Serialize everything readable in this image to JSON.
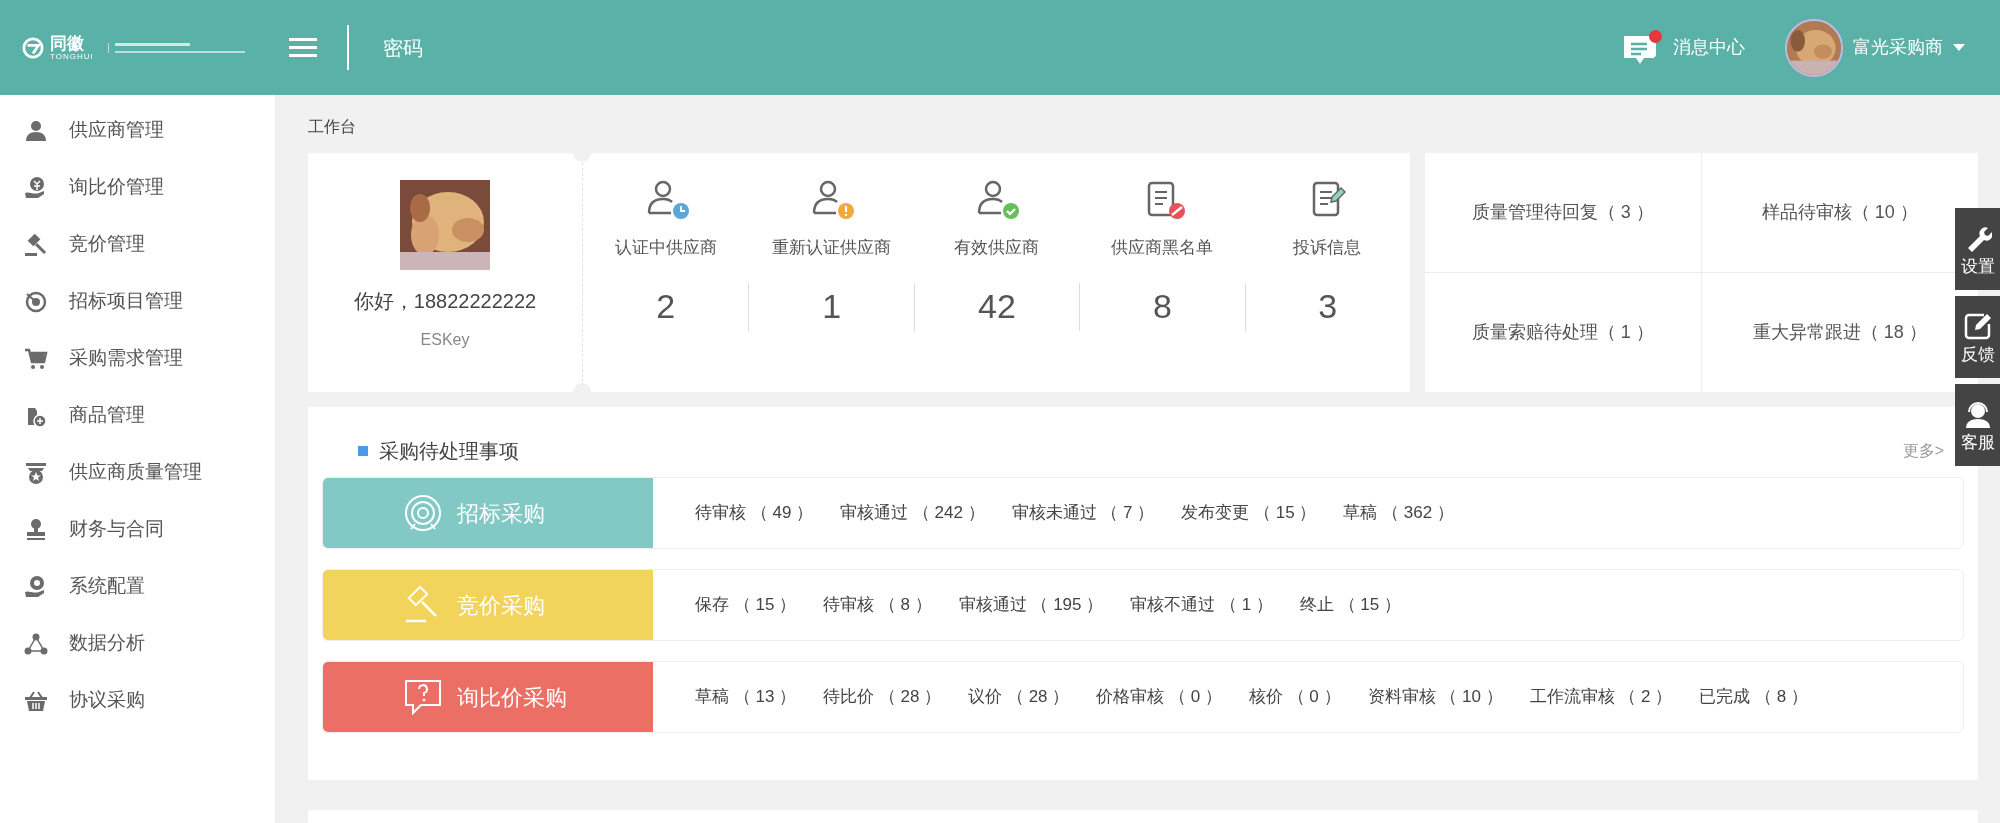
{
  "header": {
    "logo": {
      "name": "同徽",
      "subtitle": "TONGHUI"
    },
    "page_title": "密码",
    "messages": {
      "label": "消息中心",
      "unread": true
    },
    "user": {
      "name": "富光采购商"
    }
  },
  "sidebar": {
    "items": [
      {
        "kind": "person",
        "label": "供应商管理"
      },
      {
        "kind": "money",
        "label": "询比价管理"
      },
      {
        "kind": "gavel",
        "label": "竞价管理"
      },
      {
        "kind": "target",
        "label": "招标项目管理"
      },
      {
        "kind": "cart",
        "label": "采购需求管理"
      },
      {
        "kind": "tag",
        "label": "商品管理"
      },
      {
        "kind": "medal",
        "label": "供应商质量管理"
      },
      {
        "kind": "stamp",
        "label": "财务与合同"
      },
      {
        "kind": "gear",
        "label": "系统配置"
      },
      {
        "kind": "nodes",
        "label": "数据分析"
      },
      {
        "kind": "basket",
        "label": "协议采购"
      }
    ]
  },
  "breadcrumb": "工作台",
  "profile": {
    "greeting": "你好，18822222222",
    "org": "ESKey"
  },
  "stats": [
    {
      "kind": "pending",
      "label": "认证中供应商",
      "value": "2"
    },
    {
      "kind": "warning",
      "label": "重新认证供应商",
      "value": "1"
    },
    {
      "kind": "valid",
      "label": "有效供应商",
      "value": "42"
    },
    {
      "kind": "blacklist",
      "label": "供应商黑名单",
      "value": "8"
    },
    {
      "kind": "complaint",
      "label": "投诉信息",
      "value": "3"
    }
  ],
  "quick_links": [
    "质量管理待回复（ 3 ）",
    "样品待审核（ 10 ）",
    "质量索赔待处理（ 1 ）",
    "重大异常跟进（ 18 ）"
  ],
  "todo": {
    "title": "采购待处理事项",
    "more": "更多>",
    "rows": [
      {
        "kind": "target",
        "label": "招标采购",
        "color": "#82c9c6",
        "items": [
          "待审核 （ 49 ）",
          "审核通过 （ 242 ）",
          "审核未通过 （ 7 ）",
          "发布变更 （ 15 ）",
          "草稿 （ 362 ）"
        ]
      },
      {
        "kind": "gavel",
        "label": "竞价采购",
        "color": "#f2d35c",
        "items": [
          "保存 （ 15 ）",
          "待审核 （ 8 ）",
          "审核通过 （ 195 ）",
          "审核不通过 （ 1 ）",
          "终止 （ 15 ）"
        ]
      },
      {
        "kind": "question",
        "label": "询比价采购",
        "color": "#ec6f66",
        "items": [
          "草稿 （ 13 ）",
          "待比价 （ 28 ）",
          "议价 （ 28 ）",
          "价格审核 （ 0 ）",
          "核价 （ 0 ）",
          "资料审核 （ 10 ）",
          "工作流审核 （ 2 ）",
          "已完成 （ 8 ）"
        ]
      }
    ]
  },
  "float_buttons": [
    {
      "kind": "wrench",
      "label": "设置"
    },
    {
      "kind": "edit",
      "label": "反馈"
    },
    {
      "kind": "headset",
      "label": "客服"
    }
  ]
}
